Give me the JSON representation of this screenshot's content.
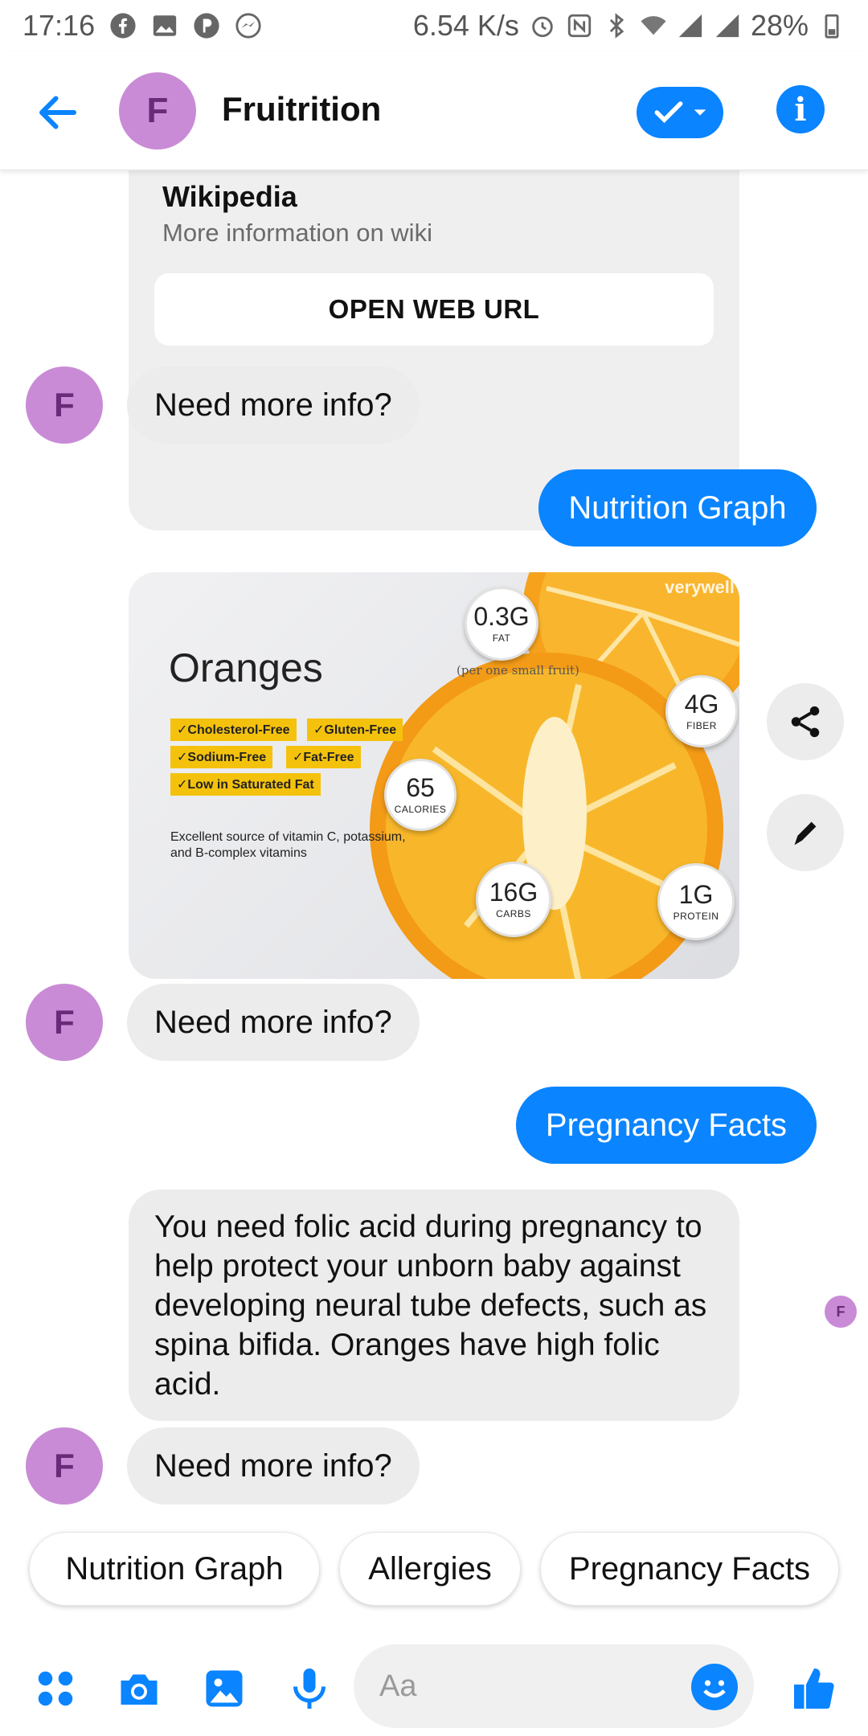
{
  "status_bar": {
    "time": "17:16",
    "speed": "6.54 K/s",
    "battery": "28%",
    "icons": [
      "facebook-icon",
      "gallery-icon",
      "p-icon",
      "messenger-icon",
      "alarm-icon",
      "nfc-icon",
      "bluetooth-icon",
      "wifi-icon",
      "signal-icon",
      "battery-icon"
    ]
  },
  "header": {
    "avatar_letter": "F",
    "title": "Fruitrition"
  },
  "messages": {
    "card_title": "Wikipedia",
    "card_subtitle": "More information on wiki",
    "card_button": "OPEN WEB URL",
    "need_more_1": "Need more info?",
    "out_1": "Nutrition Graph",
    "need_more_2": "Need more info?",
    "out_2": "Pregnancy Facts",
    "long_text": "You need folic acid during pregnancy to help protect your unborn baby against developing neural tube defects, such as spina bifida. Oranges have high folic acid.",
    "need_more_3": "Need more info?",
    "avatar_letter": "F"
  },
  "infographic": {
    "title": "Oranges",
    "serving": "(per one small fruit)",
    "tags": [
      "✓Cholesterol-Free",
      "✓Gluten-Free",
      "✓Sodium-Free",
      "✓Fat-Free",
      "✓Low in Saturated Fat"
    ],
    "description": "Excellent source of vitamin C, potassium, and B-complex vitamins",
    "watermark": "verywell",
    "badges": {
      "fat_value": "0.3G",
      "fat_label": "FAT",
      "fiber_value": "4G",
      "fiber_label": "FIBER",
      "calories_value": "65",
      "calories_label": "CALORIES",
      "carbs_value": "16G",
      "carbs_label": "CARBS",
      "protein_value": "1G",
      "protein_label": "PROTEIN"
    }
  },
  "quick_replies": [
    "Nutrition Graph",
    "Allergies",
    "Pregnancy Facts"
  ],
  "composer": {
    "placeholder": "Aa"
  },
  "colors": {
    "accent": "#0a84ff",
    "avatar_bg": "#c98bd6",
    "bubble_in": "#ececec",
    "tag_yellow": "#f4c20d"
  }
}
